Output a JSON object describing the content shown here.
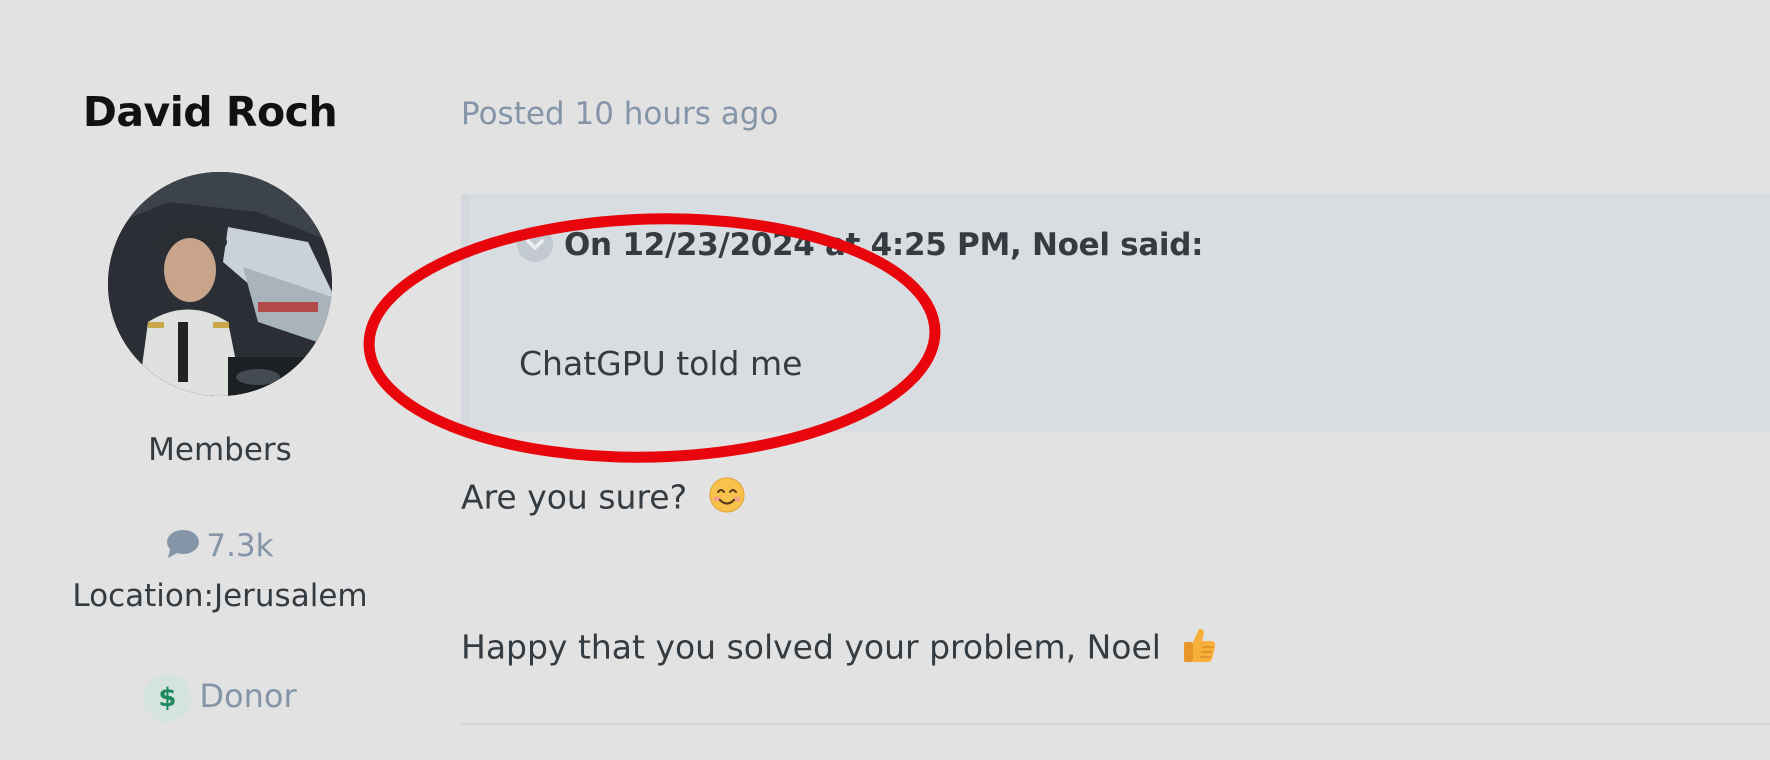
{
  "author": {
    "name": "David Roch",
    "group": "Members",
    "post_count": "7.3k",
    "location": "Location:Jerusalem",
    "badge": "Donor",
    "badge_icon": "dollar-icon",
    "post_count_icon": "chat-bubble-icon"
  },
  "post": {
    "meta": "Posted 10 hours ago",
    "quote": {
      "citation": "On 12/23/2024 at 4:25 PM, Noel said:",
      "text": "ChatGPU told me"
    },
    "lines": [
      "Are you sure?",
      "Happy that you solved your problem, Noel"
    ],
    "emojis": [
      "smiling-face-emoji",
      "thumbs-up-emoji"
    ]
  },
  "colors": {
    "background": "#e2e2e3",
    "muted_text": "#8595a8",
    "body_text": "#353c41",
    "quote_bg": "#d9dde1",
    "annotation": "#e8060c",
    "donor_green": "#1f8a5f"
  }
}
